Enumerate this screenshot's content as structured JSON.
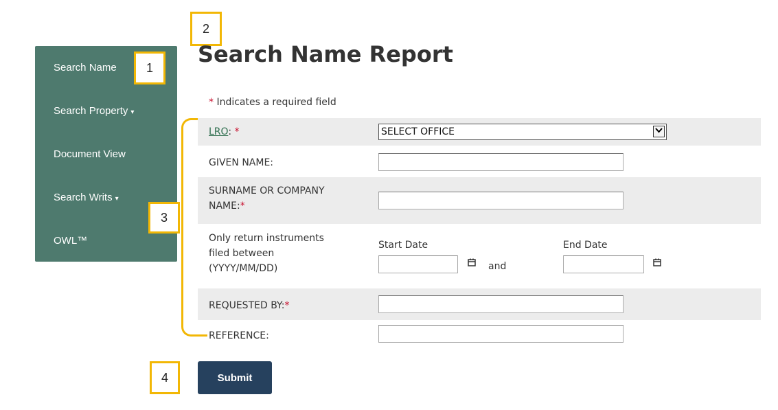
{
  "sidebar": {
    "items": [
      {
        "label": "Search Name",
        "dropdown": false
      },
      {
        "label": "Search Property",
        "dropdown": true
      },
      {
        "label": "Document View",
        "dropdown": false
      },
      {
        "label": "Search Writs",
        "dropdown": true
      },
      {
        "label": "OWL™",
        "dropdown": false
      }
    ]
  },
  "callouts": [
    "1",
    "2",
    "3",
    "4"
  ],
  "page": {
    "title": "Search Name Report",
    "required_star": "*",
    "required_note": "Indicates a required field"
  },
  "form": {
    "lro": {
      "label": "LRO",
      "colon": ":",
      "star": "*",
      "value": "SELECT OFFICE"
    },
    "given_name": {
      "label": "GIVEN NAME:",
      "value": ""
    },
    "surname": {
      "label_line1": "SURNAME OR COMPANY",
      "label_line2": "NAME:",
      "star": "*",
      "value": ""
    },
    "date_range": {
      "label_line1": "Only return instruments",
      "label_line2": "filed between",
      "label_line3": "(YYYY/MM/DD)",
      "start_label": "Start Date",
      "end_label": "End Date",
      "and_text": "and",
      "start_value": "",
      "end_value": ""
    },
    "requested_by": {
      "label": "REQUESTED BY:",
      "star": "*",
      "value": ""
    },
    "reference": {
      "label": "REFERENCE:",
      "value": ""
    }
  },
  "actions": {
    "submit_label": "Submit"
  },
  "colors": {
    "sidebar_bg": "#4e7a6e",
    "callout_border": "#f2b705",
    "required": "#c8102e",
    "submit_bg": "#26415e",
    "row_shade": "#ececec"
  },
  "icons": [
    "chevron-down-icon",
    "calendar-icon"
  ]
}
